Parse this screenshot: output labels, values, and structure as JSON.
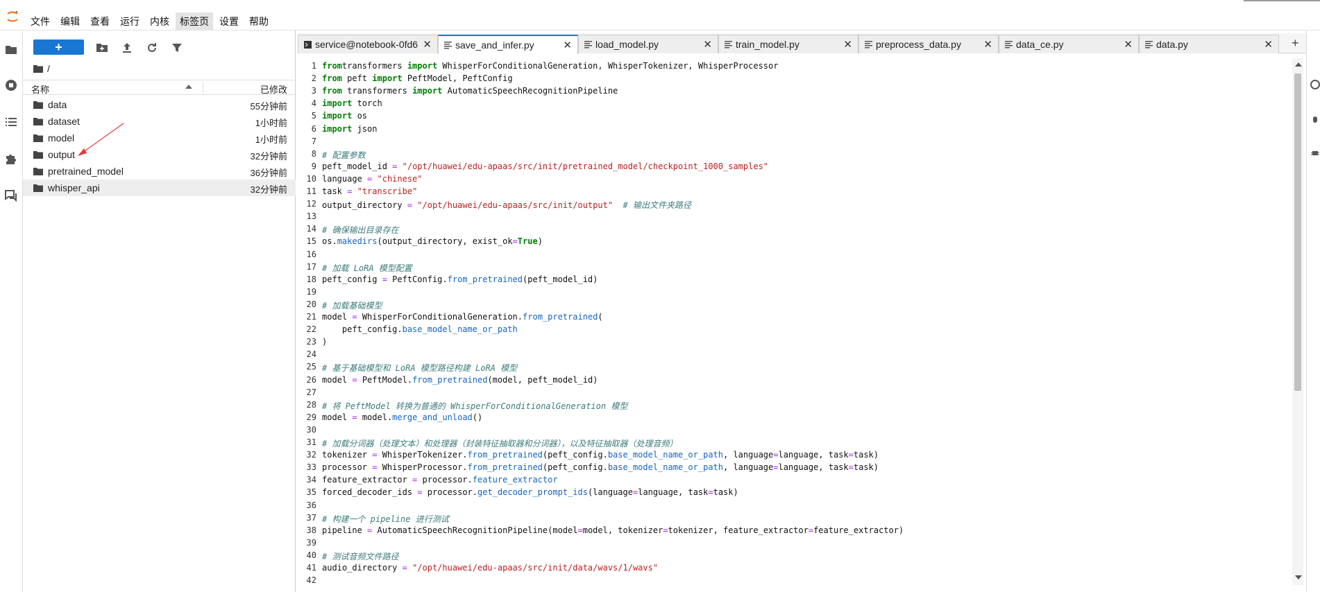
{
  "menubar": {
    "items": [
      "文件",
      "编辑",
      "查看",
      "运行",
      "内核",
      "标签页",
      "设置",
      "帮助"
    ],
    "active_index": 5
  },
  "filebrowser": {
    "new_label": "+",
    "path": "/",
    "header": {
      "name": "名称",
      "modified": "已修改"
    },
    "items": [
      {
        "name": "data",
        "modified": "55分钟前"
      },
      {
        "name": "dataset",
        "modified": "1小时前"
      },
      {
        "name": "model",
        "modified": "1小时前"
      },
      {
        "name": "output",
        "modified": "32分钟前"
      },
      {
        "name": "pretrained_model",
        "modified": "36分钟前"
      },
      {
        "name": "whisper_api",
        "modified": "32分钟前"
      }
    ],
    "selected_index": 5
  },
  "tabs": [
    {
      "label": "service@notebook-0fd6",
      "type": "terminal"
    },
    {
      "label": "save_and_infer.py",
      "type": "file",
      "active": true
    },
    {
      "label": "load_model.py",
      "type": "file"
    },
    {
      "label": "train_model.py",
      "type": "file"
    },
    {
      "label": "preprocess_data.py",
      "type": "file"
    },
    {
      "label": "data_ce.py",
      "type": "file"
    },
    {
      "label": "data.py",
      "type": "file"
    }
  ],
  "tab_add_label": "+",
  "editor": {
    "lines": [
      [
        [
          "kw",
          "from"
        ],
        [
          "",
          "transformers "
        ],
        [
          "kw",
          "import"
        ],
        [
          "",
          " WhisperForConditionalGeneration, WhisperTokenizer, WhisperProcessor"
        ]
      ],
      [
        [
          "kw",
          "from"
        ],
        [
          "",
          " peft "
        ],
        [
          "kw",
          "import"
        ],
        [
          "",
          " PeftModel, PeftConfig"
        ]
      ],
      [
        [
          "kw",
          "from"
        ],
        [
          "",
          " transformers "
        ],
        [
          "kw",
          "import"
        ],
        [
          "",
          " AutomaticSpeechRecognitionPipeline"
        ]
      ],
      [
        [
          "kw",
          "import"
        ],
        [
          "",
          " torch"
        ]
      ],
      [
        [
          "kw",
          "import"
        ],
        [
          "",
          " os"
        ]
      ],
      [
        [
          "kw",
          "import"
        ],
        [
          "",
          " json"
        ]
      ],
      [],
      [
        [
          "cm",
          "# 配置参数"
        ]
      ],
      [
        [
          "",
          "peft_model_id "
        ],
        [
          "op",
          "="
        ],
        [
          "",
          " "
        ],
        [
          "str",
          "\"/opt/huawei/edu-apaas/src/init/pretrained_model/checkpoint_1000_samples\""
        ]
      ],
      [
        [
          "",
          "language "
        ],
        [
          "op",
          "="
        ],
        [
          "",
          " "
        ],
        [
          "str",
          "\"chinese\""
        ]
      ],
      [
        [
          "",
          "task "
        ],
        [
          "op",
          "="
        ],
        [
          "",
          " "
        ],
        [
          "str",
          "\"transcribe\""
        ]
      ],
      [
        [
          "",
          "output_directory "
        ],
        [
          "op",
          "="
        ],
        [
          "",
          " "
        ],
        [
          "str",
          "\"/opt/huawei/edu-apaas/src/init/output\""
        ],
        [
          "",
          "  "
        ],
        [
          "cm",
          "# 输出文件夹路径"
        ]
      ],
      [],
      [
        [
          "cm",
          "# 确保输出目录存在"
        ]
      ],
      [
        [
          "",
          "os."
        ],
        [
          "fn",
          "makedirs"
        ],
        [
          "",
          "(output_directory, exist_ok"
        ],
        [
          "op",
          "="
        ],
        [
          "kw",
          "True"
        ],
        [
          "",
          ")"
        ]
      ],
      [],
      [
        [
          "cm",
          "# 加载 LoRA 模型配置"
        ]
      ],
      [
        [
          "",
          "peft_config "
        ],
        [
          "op",
          "="
        ],
        [
          "",
          " PeftConfig."
        ],
        [
          "fn",
          "from_pretrained"
        ],
        [
          "",
          "(peft_model_id)"
        ]
      ],
      [],
      [
        [
          "cm",
          "# 加载基础模型"
        ]
      ],
      [
        [
          "",
          "model "
        ],
        [
          "op",
          "="
        ],
        [
          "",
          " WhisperForConditionalGeneration."
        ],
        [
          "fn",
          "from_pretrained"
        ],
        [
          "",
          "("
        ]
      ],
      [
        [
          "",
          "    peft_config."
        ],
        [
          "fn",
          "base_model_name_or_path"
        ]
      ],
      [
        [
          "",
          ")"
        ]
      ],
      [],
      [
        [
          "cm",
          "# 基于基础模型和 LoRA 模型路径构建 LoRA 模型"
        ]
      ],
      [
        [
          "",
          "model "
        ],
        [
          "op",
          "="
        ],
        [
          "",
          " PeftModel."
        ],
        [
          "fn",
          "from_pretrained"
        ],
        [
          "",
          "(model, peft_model_id)"
        ]
      ],
      [],
      [
        [
          "cm",
          "# 将 PeftModel 转换为普通的 WhisperForConditionalGeneration 模型"
        ]
      ],
      [
        [
          "",
          "model "
        ],
        [
          "op",
          "="
        ],
        [
          "",
          " model."
        ],
        [
          "fn",
          "merge_and_unload"
        ],
        [
          "",
          "()"
        ]
      ],
      [],
      [
        [
          "cm",
          "# 加载分词器（处理文本）和处理器（封装特征抽取器和分词器），以及特征抽取器（处理音频）"
        ]
      ],
      [
        [
          "",
          "tokenizer "
        ],
        [
          "op",
          "="
        ],
        [
          "",
          " WhisperTokenizer."
        ],
        [
          "fn",
          "from_pretrained"
        ],
        [
          "",
          "(peft_config."
        ],
        [
          "fn",
          "base_model_name_or_path"
        ],
        [
          "",
          ", language"
        ],
        [
          "op",
          "="
        ],
        [
          "",
          "language, task"
        ],
        [
          "op",
          "="
        ],
        [
          "",
          "task)"
        ]
      ],
      [
        [
          "",
          "processor "
        ],
        [
          "op",
          "="
        ],
        [
          "",
          " WhisperProcessor."
        ],
        [
          "fn",
          "from_pretrained"
        ],
        [
          "",
          "(peft_config."
        ],
        [
          "fn",
          "base_model_name_or_path"
        ],
        [
          "",
          ", language"
        ],
        [
          "op",
          "="
        ],
        [
          "",
          "language, task"
        ],
        [
          "op",
          "="
        ],
        [
          "",
          "task)"
        ]
      ],
      [
        [
          "",
          "feature_extractor "
        ],
        [
          "op",
          "="
        ],
        [
          "",
          " processor."
        ],
        [
          "fn",
          "feature_extractor"
        ]
      ],
      [
        [
          "",
          "forced_decoder_ids "
        ],
        [
          "op",
          "="
        ],
        [
          "",
          " processor."
        ],
        [
          "fn",
          "get_decoder_prompt_ids"
        ],
        [
          "",
          "(language"
        ],
        [
          "op",
          "="
        ],
        [
          "",
          "language, task"
        ],
        [
          "op",
          "="
        ],
        [
          "",
          "task)"
        ]
      ],
      [],
      [
        [
          "cm",
          "# 构建一个 pipeline 进行测试"
        ]
      ],
      [
        [
          "",
          "pipeline "
        ],
        [
          "op",
          "="
        ],
        [
          "",
          " AutomaticSpeechRecognitionPipeline(model"
        ],
        [
          "op",
          "="
        ],
        [
          "",
          "model, tokenizer"
        ],
        [
          "op",
          "="
        ],
        [
          "",
          "tokenizer, feature_extractor"
        ],
        [
          "op",
          "="
        ],
        [
          "",
          "feature_extractor)"
        ]
      ],
      [],
      [
        [
          "cm",
          "# 测试音频文件路径"
        ]
      ],
      [
        [
          "",
          "audio_directory "
        ],
        [
          "op",
          "="
        ],
        [
          "",
          " "
        ],
        [
          "str",
          "\"/opt/huawei/edu-apaas/src/init/data/wavs/1/wavs\""
        ]
      ],
      []
    ]
  },
  "colors": {
    "accent": "#1976d2",
    "annotation_arrow": "#e53935"
  }
}
